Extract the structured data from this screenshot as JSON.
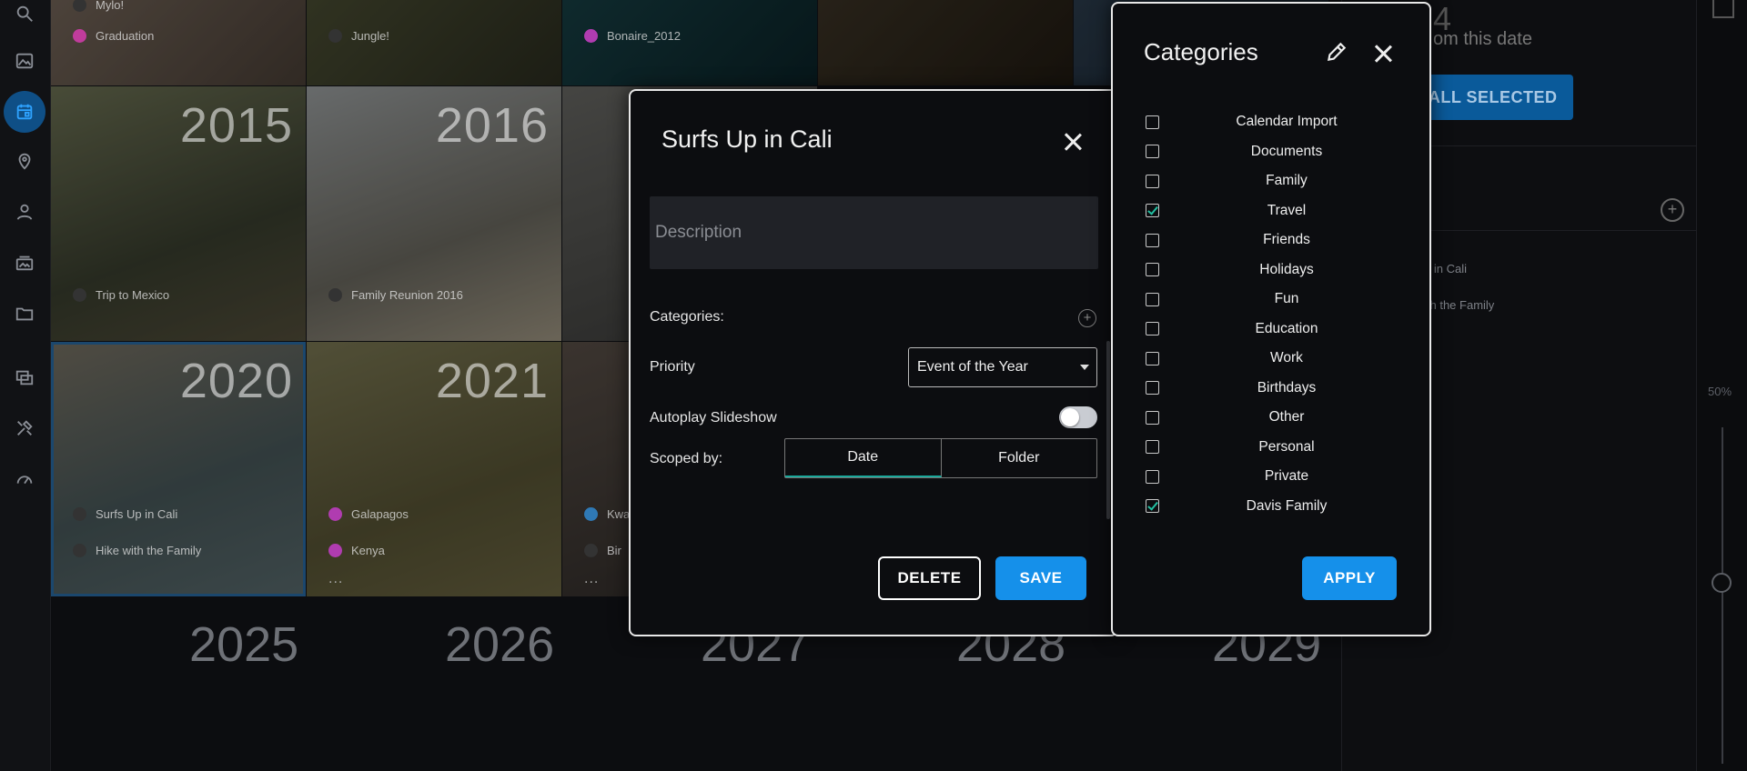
{
  "sidebar": {
    "icons": [
      "search-icon",
      "image-icon",
      "calendar-icon",
      "location-icon",
      "person-icon",
      "album-icon",
      "folder-icon",
      "slideshow-icon",
      "tools-icon",
      "dashboard-icon"
    ]
  },
  "grid": {
    "top_row": [
      {
        "events": [
          "Mylo!",
          "Graduation"
        ],
        "dots": [
          "#333",
          "#c03c9c"
        ]
      },
      {
        "events": [
          "Jungle!"
        ],
        "dots": [
          "#333"
        ]
      },
      {
        "events": [
          "Bonaire_2012"
        ],
        "dots": [
          "#b03cb0"
        ]
      }
    ],
    "tiles": [
      {
        "year": "2015",
        "events": [
          "Trip to Mexico"
        ],
        "dots": [
          "#333"
        ]
      },
      {
        "year": "2016",
        "events": [
          "Family Reunion 2016"
        ],
        "dots": [
          "#333"
        ]
      },
      {
        "year": "2020",
        "events": [
          "Surfs Up in Cali",
          "Hike with the Family"
        ],
        "dots": [
          "#333",
          "#333"
        ]
      },
      {
        "year": "2021",
        "events": [
          "Galapagos",
          "Kenya"
        ],
        "dots": [
          "#b03cb0",
          "#b03cb0"
        ],
        "more": "..."
      },
      {
        "year": "",
        "events": [
          "Kwa",
          "Bir"
        ],
        "dots": [
          "#2f79b5",
          "#333"
        ],
        "more": "..."
      }
    ],
    "bottom_years": [
      "2025",
      "2026",
      "2027",
      "2028",
      "2029"
    ]
  },
  "right_panel": {
    "count": "4",
    "from_text": "om this date",
    "view_button": "V ALL SELECTED",
    "items": [
      "p in Cali",
      "ith the Family"
    ]
  },
  "zoom": {
    "label": "50%",
    "level_pct": 50
  },
  "modal": {
    "title": "Surfs Up in Cali",
    "description_placeholder": "Description",
    "categories_label": "Categories:",
    "priority_label": "Priority",
    "priority_value": "Event of the Year",
    "autoplay_label": "Autoplay Slideshow",
    "autoplay_on": false,
    "scoped_label": "Scoped by:",
    "scope_options": [
      "Date",
      "Folder"
    ],
    "scope_selected": "Date",
    "delete_label": "DELETE",
    "save_label": "SAVE"
  },
  "categories_panel": {
    "title": "Categories",
    "items": [
      {
        "label": "Calendar Import",
        "checked": false
      },
      {
        "label": "Documents",
        "checked": false
      },
      {
        "label": "Family",
        "checked": false
      },
      {
        "label": "Travel",
        "checked": true
      },
      {
        "label": "Friends",
        "checked": false
      },
      {
        "label": "Holidays",
        "checked": false
      },
      {
        "label": "Fun",
        "checked": false
      },
      {
        "label": "Education",
        "checked": false
      },
      {
        "label": "Work",
        "checked": false
      },
      {
        "label": "Birthdays",
        "checked": false
      },
      {
        "label": "Other",
        "checked": false
      },
      {
        "label": "Personal",
        "checked": false
      },
      {
        "label": "Private",
        "checked": false
      },
      {
        "label": "Davis Family",
        "checked": true
      }
    ],
    "apply_label": "APPLY",
    "check_color": "#22c0a2",
    "accent_color": "#1590ea"
  }
}
